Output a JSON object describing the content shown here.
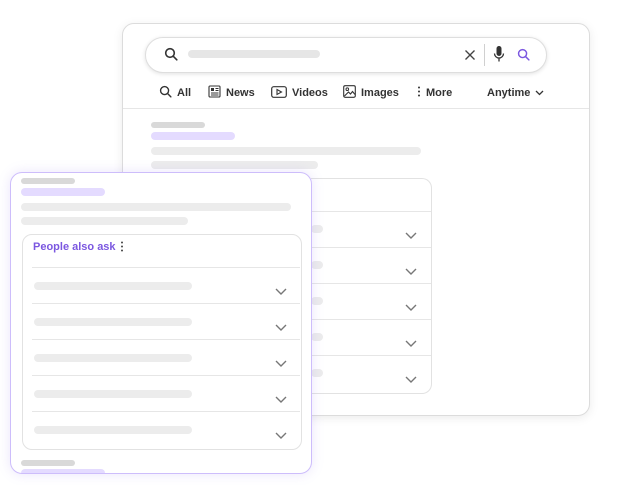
{
  "search": {
    "tabs": [
      {
        "label": "All",
        "icon": "search-icon"
      },
      {
        "label": "News",
        "icon": "news-icon"
      },
      {
        "label": "Videos",
        "icon": "video-icon"
      },
      {
        "label": "Images",
        "icon": "image-icon"
      },
      {
        "label": "More",
        "icon": "more-icon"
      }
    ],
    "time_filter": "Anytime"
  },
  "people_also_ask": {
    "title": "People also ask"
  },
  "colors": {
    "accent": "#7b57e0",
    "placeholder": "#ececec",
    "placeholder_accent": "#e4dbff"
  }
}
